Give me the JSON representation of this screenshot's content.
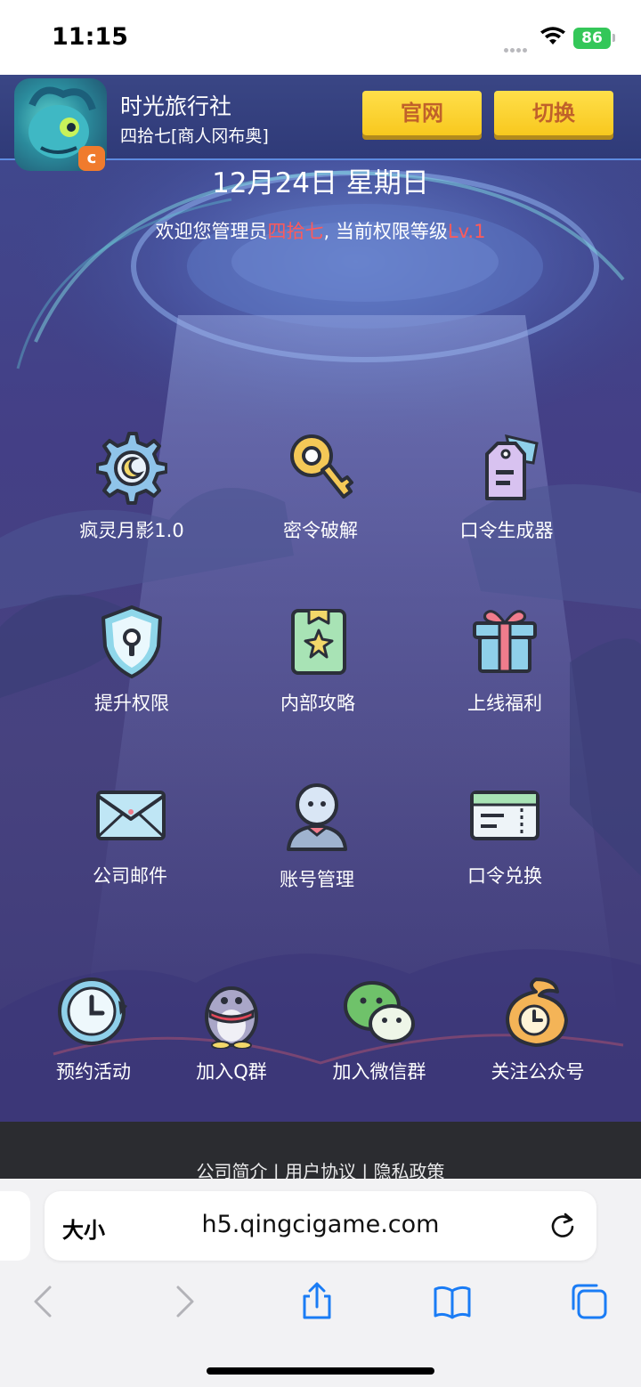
{
  "status_bar": {
    "time": "11:15",
    "battery": "86"
  },
  "header": {
    "app_title": "时光旅行社",
    "app_subtitle": "四拾七[商人冈布奥]",
    "buttons": [
      "官网",
      "切换"
    ]
  },
  "date": "12月24日 星期日",
  "welcome": {
    "prefix": "欢迎您管理员",
    "name": "四拾七",
    "middle": ", 当前权限等级",
    "level": "Lv.1"
  },
  "menu": [
    {
      "label": "疯灵月影1.0",
      "icon": "gear-moon-icon"
    },
    {
      "label": "密令破解",
      "icon": "key-icon"
    },
    {
      "label": "口令生成器",
      "icon": "tag-icon"
    },
    {
      "label": "提升权限",
      "icon": "shield-icon"
    },
    {
      "label": "内部攻略",
      "icon": "guide-book-icon"
    },
    {
      "label": "上线福利",
      "icon": "gift-icon"
    },
    {
      "label": "公司邮件",
      "icon": "envelope-icon"
    },
    {
      "label": "账号管理",
      "icon": "user-icon"
    },
    {
      "label": "口令兑换",
      "icon": "ticket-icon"
    }
  ],
  "social": [
    {
      "label": "预约活动",
      "icon": "clock-icon"
    },
    {
      "label": "加入Q群",
      "icon": "qq-penguin-icon"
    },
    {
      "label": "加入微信群",
      "icon": "wechat-icon"
    },
    {
      "label": "关注公众号",
      "icon": "official-account-icon"
    }
  ],
  "footer": {
    "links": "公司简介 | 用户协议 | 隐私政策"
  },
  "browser": {
    "text_size": "大小",
    "url": "h5.qingcigame.com"
  }
}
